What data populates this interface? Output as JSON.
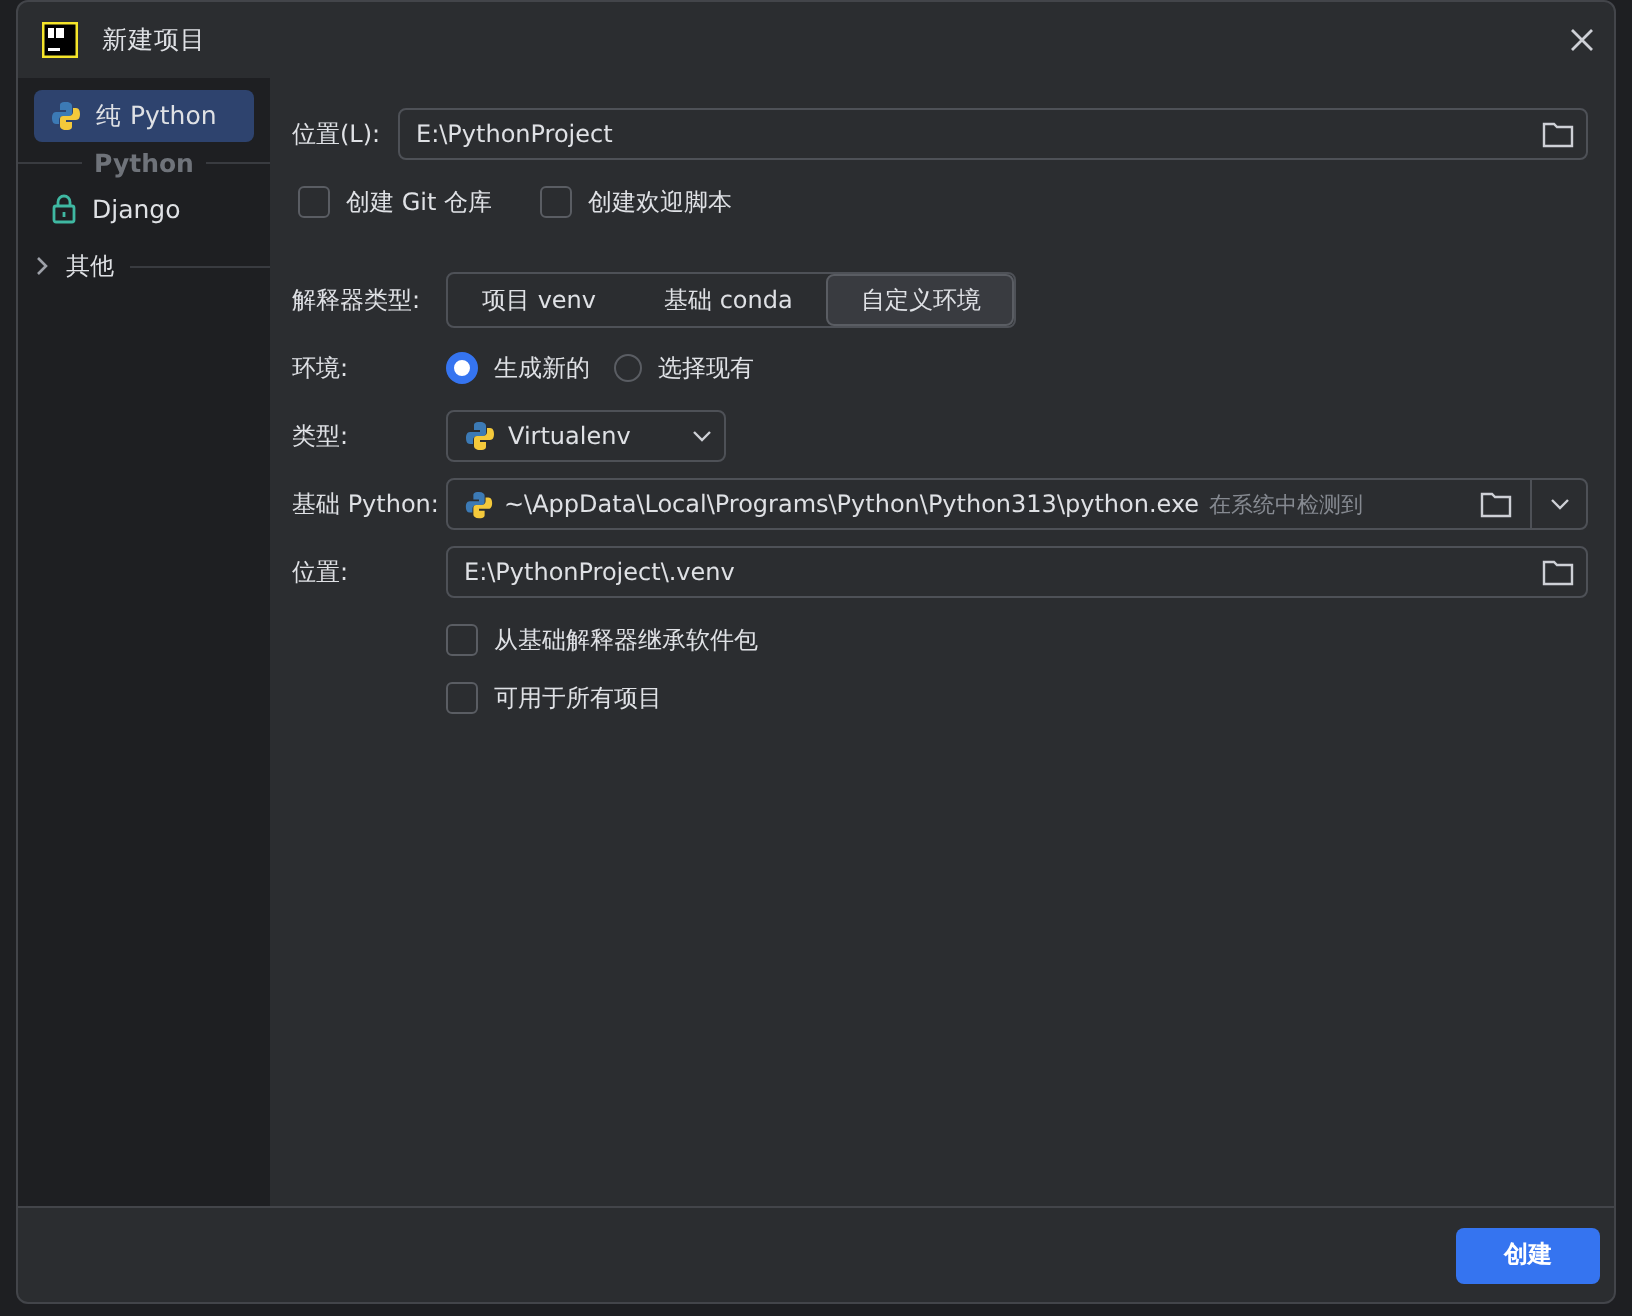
{
  "window": {
    "title": "新建项目"
  },
  "sidebar": {
    "items": [
      {
        "label": "纯 Python",
        "selected": true,
        "kind": "python"
      }
    ],
    "group": {
      "title": "Python",
      "items": [
        {
          "label": "Django",
          "selected": false,
          "kind": "lock"
        }
      ]
    },
    "other": {
      "label": "其他",
      "expanded": false
    }
  },
  "location": {
    "label": "位置(L):",
    "value": "E:\\PythonProject"
  },
  "options": [
    {
      "label": "创建 Git 仓库",
      "checked": false
    },
    {
      "label": "创建欢迎脚本",
      "checked": false
    }
  ],
  "interpreter_type": {
    "label": "解释器类型:",
    "tabs": [
      {
        "label": "项目 venv",
        "selected": false
      },
      {
        "label": "基础 conda",
        "selected": false
      },
      {
        "label": "自定义环境",
        "selected": true
      }
    ]
  },
  "environment": {
    "label": "环境:",
    "choices": [
      {
        "label": "生成新的",
        "selected": true
      },
      {
        "label": "选择现有",
        "selected": false
      }
    ]
  },
  "type": {
    "label": "类型:",
    "value": "Virtualenv"
  },
  "base_python": {
    "label": "基础 Python:",
    "value": "~\\AppData\\Local\\Programs\\Python\\Python313\\python.exe",
    "hint": "在系统中检测到"
  },
  "venv_location": {
    "label": "位置:",
    "value": "E:\\PythonProject\\.venv"
  },
  "venv_options": [
    {
      "label": "从基础解释器继承软件包",
      "checked": false
    },
    {
      "label": "可用于所有项目",
      "checked": false
    }
  ],
  "buttons": [
    {
      "label": "创建"
    }
  ]
}
